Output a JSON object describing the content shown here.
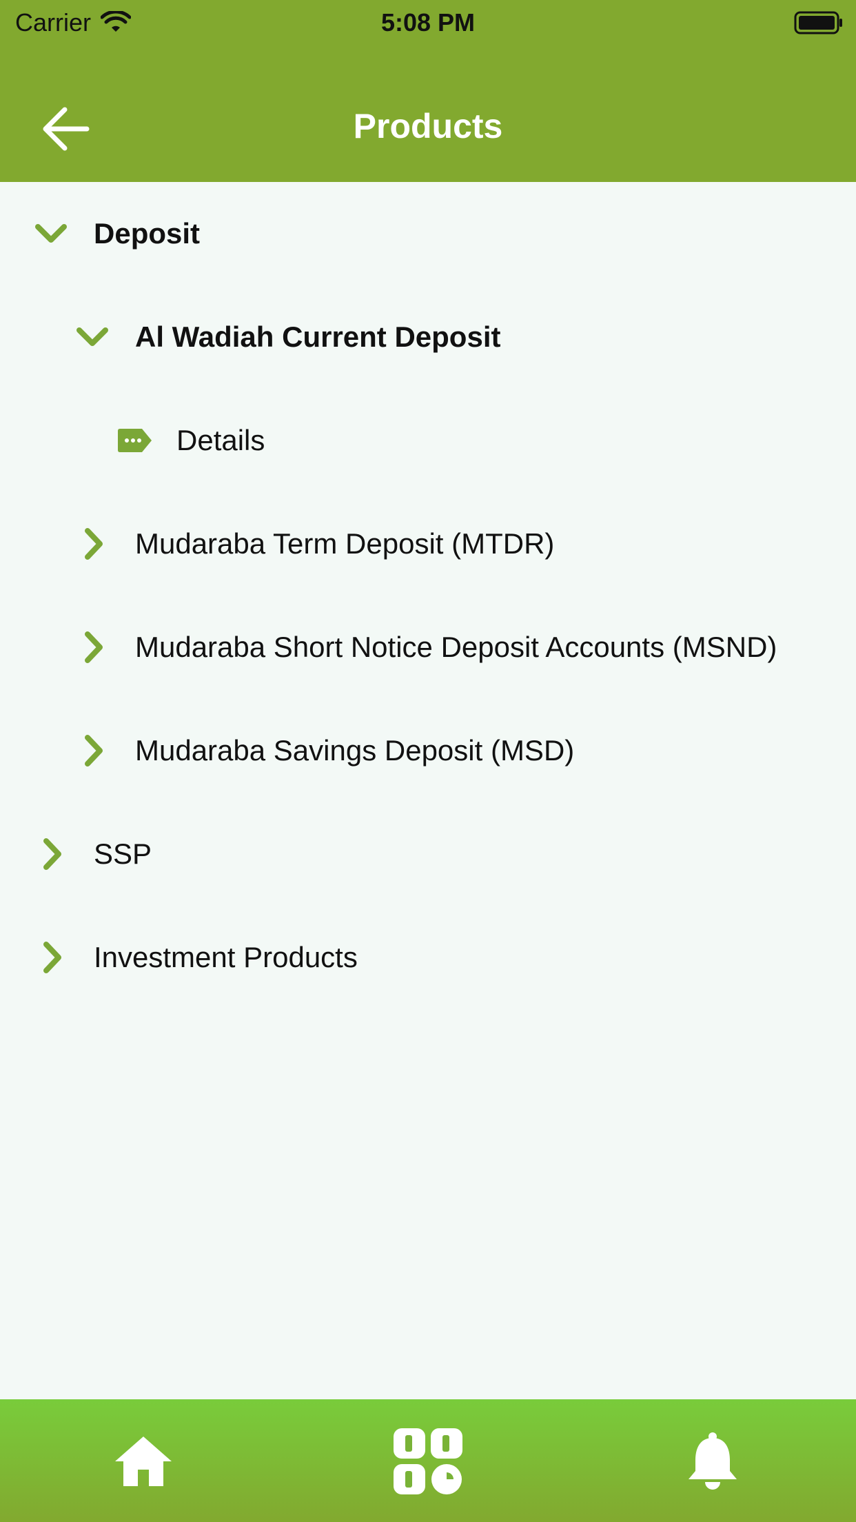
{
  "status_bar": {
    "carrier": "Carrier",
    "time": "5:08 PM"
  },
  "nav": {
    "title": "Products",
    "back_icon": "back-arrow-icon"
  },
  "tree": {
    "rows": [
      {
        "label": "Deposit",
        "level": 0,
        "expanded": true,
        "bold": true,
        "icon": "chevron-down-icon"
      },
      {
        "label": "Al Wadiah Current Deposit",
        "level": 1,
        "expanded": true,
        "bold": true,
        "icon": "chevron-down-icon"
      },
      {
        "label": "Details",
        "level": 2,
        "leaf": true,
        "icon": "tag-icon"
      },
      {
        "label": "Mudaraba Term Deposit (MTDR)",
        "level": 1,
        "expanded": false,
        "icon": "chevron-right-icon"
      },
      {
        "label": "Mudaraba Short Notice Deposit Accounts (MSND)",
        "level": 1,
        "expanded": false,
        "icon": "chevron-right-icon"
      },
      {
        "label": "Mudaraba Savings Deposit (MSD)",
        "level": 1,
        "expanded": false,
        "icon": "chevron-right-icon"
      },
      {
        "label": "SSP",
        "level": 0,
        "expanded": false,
        "icon": "chevron-right-icon"
      },
      {
        "label": "Investment Products",
        "level": 0,
        "expanded": false,
        "icon": "chevron-right-icon"
      }
    ]
  },
  "tabbar": {
    "tabs": [
      {
        "icon": "home-icon"
      },
      {
        "icon": "apps-grid-icon"
      },
      {
        "icon": "bell-icon"
      }
    ]
  },
  "colors": {
    "header": "#82a92f",
    "accent": "#7ba737",
    "background": "#f3f9f6",
    "tabbar_top": "#79cc3b"
  }
}
